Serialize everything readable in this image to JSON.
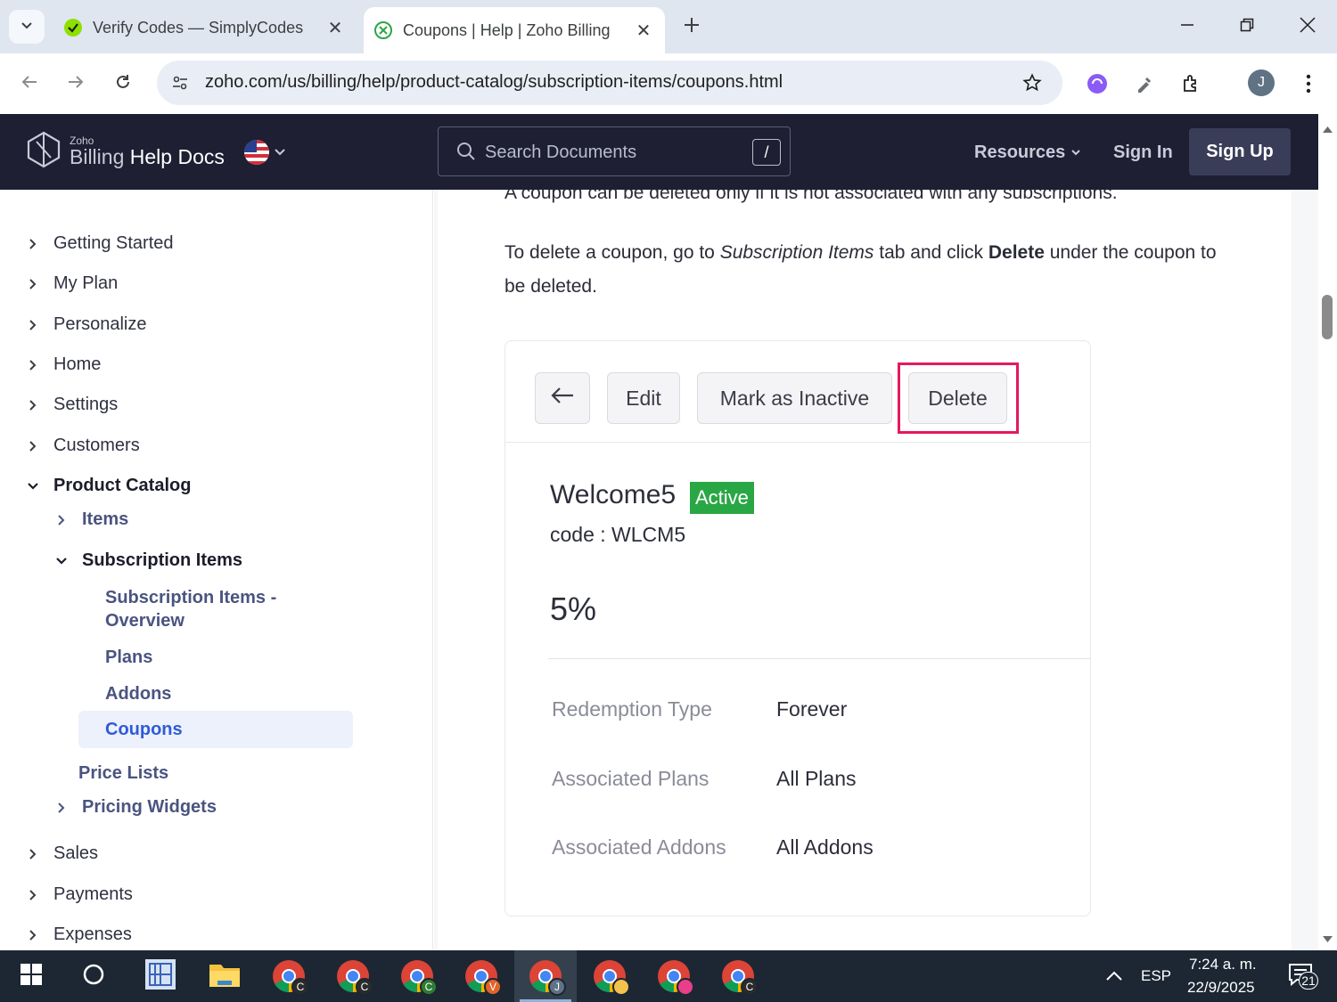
{
  "browser": {
    "tabs": [
      {
        "title": "Verify Codes — SimplyCodes",
        "active": false
      },
      {
        "title": "Coupons | Help | Zoho Billing",
        "active": true
      }
    ],
    "url": "zoho.com/us/billing/help/product-catalog/subscription-items/coupons.html",
    "profile_initial": "J"
  },
  "site_header": {
    "logo_small": "Zoho",
    "logo_product": "Billing",
    "logo_suffix": "Help Docs",
    "search_placeholder": "Search Documents",
    "search_shortcut": "/",
    "resources_label": "Resources",
    "signin_label": "Sign In",
    "signup_label": "Sign Up"
  },
  "sidebar": {
    "items": [
      {
        "label": "Getting Started"
      },
      {
        "label": "My Plan"
      },
      {
        "label": "Personalize"
      },
      {
        "label": "Home"
      },
      {
        "label": "Settings"
      },
      {
        "label": "Customers"
      },
      {
        "label": "Product Catalog",
        "expanded": true
      },
      {
        "label": "Items"
      },
      {
        "label": "Subscription Items",
        "expanded": true
      },
      {
        "label": "Subscription Items -"
      },
      {
        "label": "Overview"
      },
      {
        "label": "Plans"
      },
      {
        "label": "Addons"
      },
      {
        "label": "Coupons",
        "active": true
      },
      {
        "label": "Price Lists"
      },
      {
        "label": "Pricing Widgets"
      },
      {
        "label": "Sales"
      },
      {
        "label": "Payments"
      },
      {
        "label": "Expenses"
      }
    ]
  },
  "article": {
    "partial_line": "A coupon can be deleted only if it is not associated with any subscriptions.",
    "para_1": "To delete a coupon, go to ",
    "para_em": "Subscription Items",
    "para_2": " tab and click ",
    "para_bold": "Delete",
    "para_3": " under the coupon to be deleted."
  },
  "screenshot": {
    "buttons": {
      "edit": "Edit",
      "mark_inactive": "Mark as Inactive",
      "delete": "Delete"
    },
    "coupon_name": "Welcome5",
    "status": "Active",
    "code_line": "code : WLCM5",
    "discount": "5%",
    "details": [
      {
        "label": "Redemption Type",
        "value": "Forever"
      },
      {
        "label": "Associated Plans",
        "value": "All Plans"
      },
      {
        "label": "Associated Addons",
        "value": "All Addons"
      }
    ]
  },
  "taskbar": {
    "language": "ESP",
    "time": "7:24 a. m.",
    "date": "22/9/2025",
    "notifications": "21",
    "chrome_profiles": [
      "C",
      "C",
      "C",
      "V",
      "J",
      "",
      "",
      "C"
    ]
  },
  "colors": {
    "header_bg": "#1e1f33",
    "active_badge": "#2aa745",
    "highlight": "#e5195f",
    "sidebar_active": "#2f5bd8"
  }
}
